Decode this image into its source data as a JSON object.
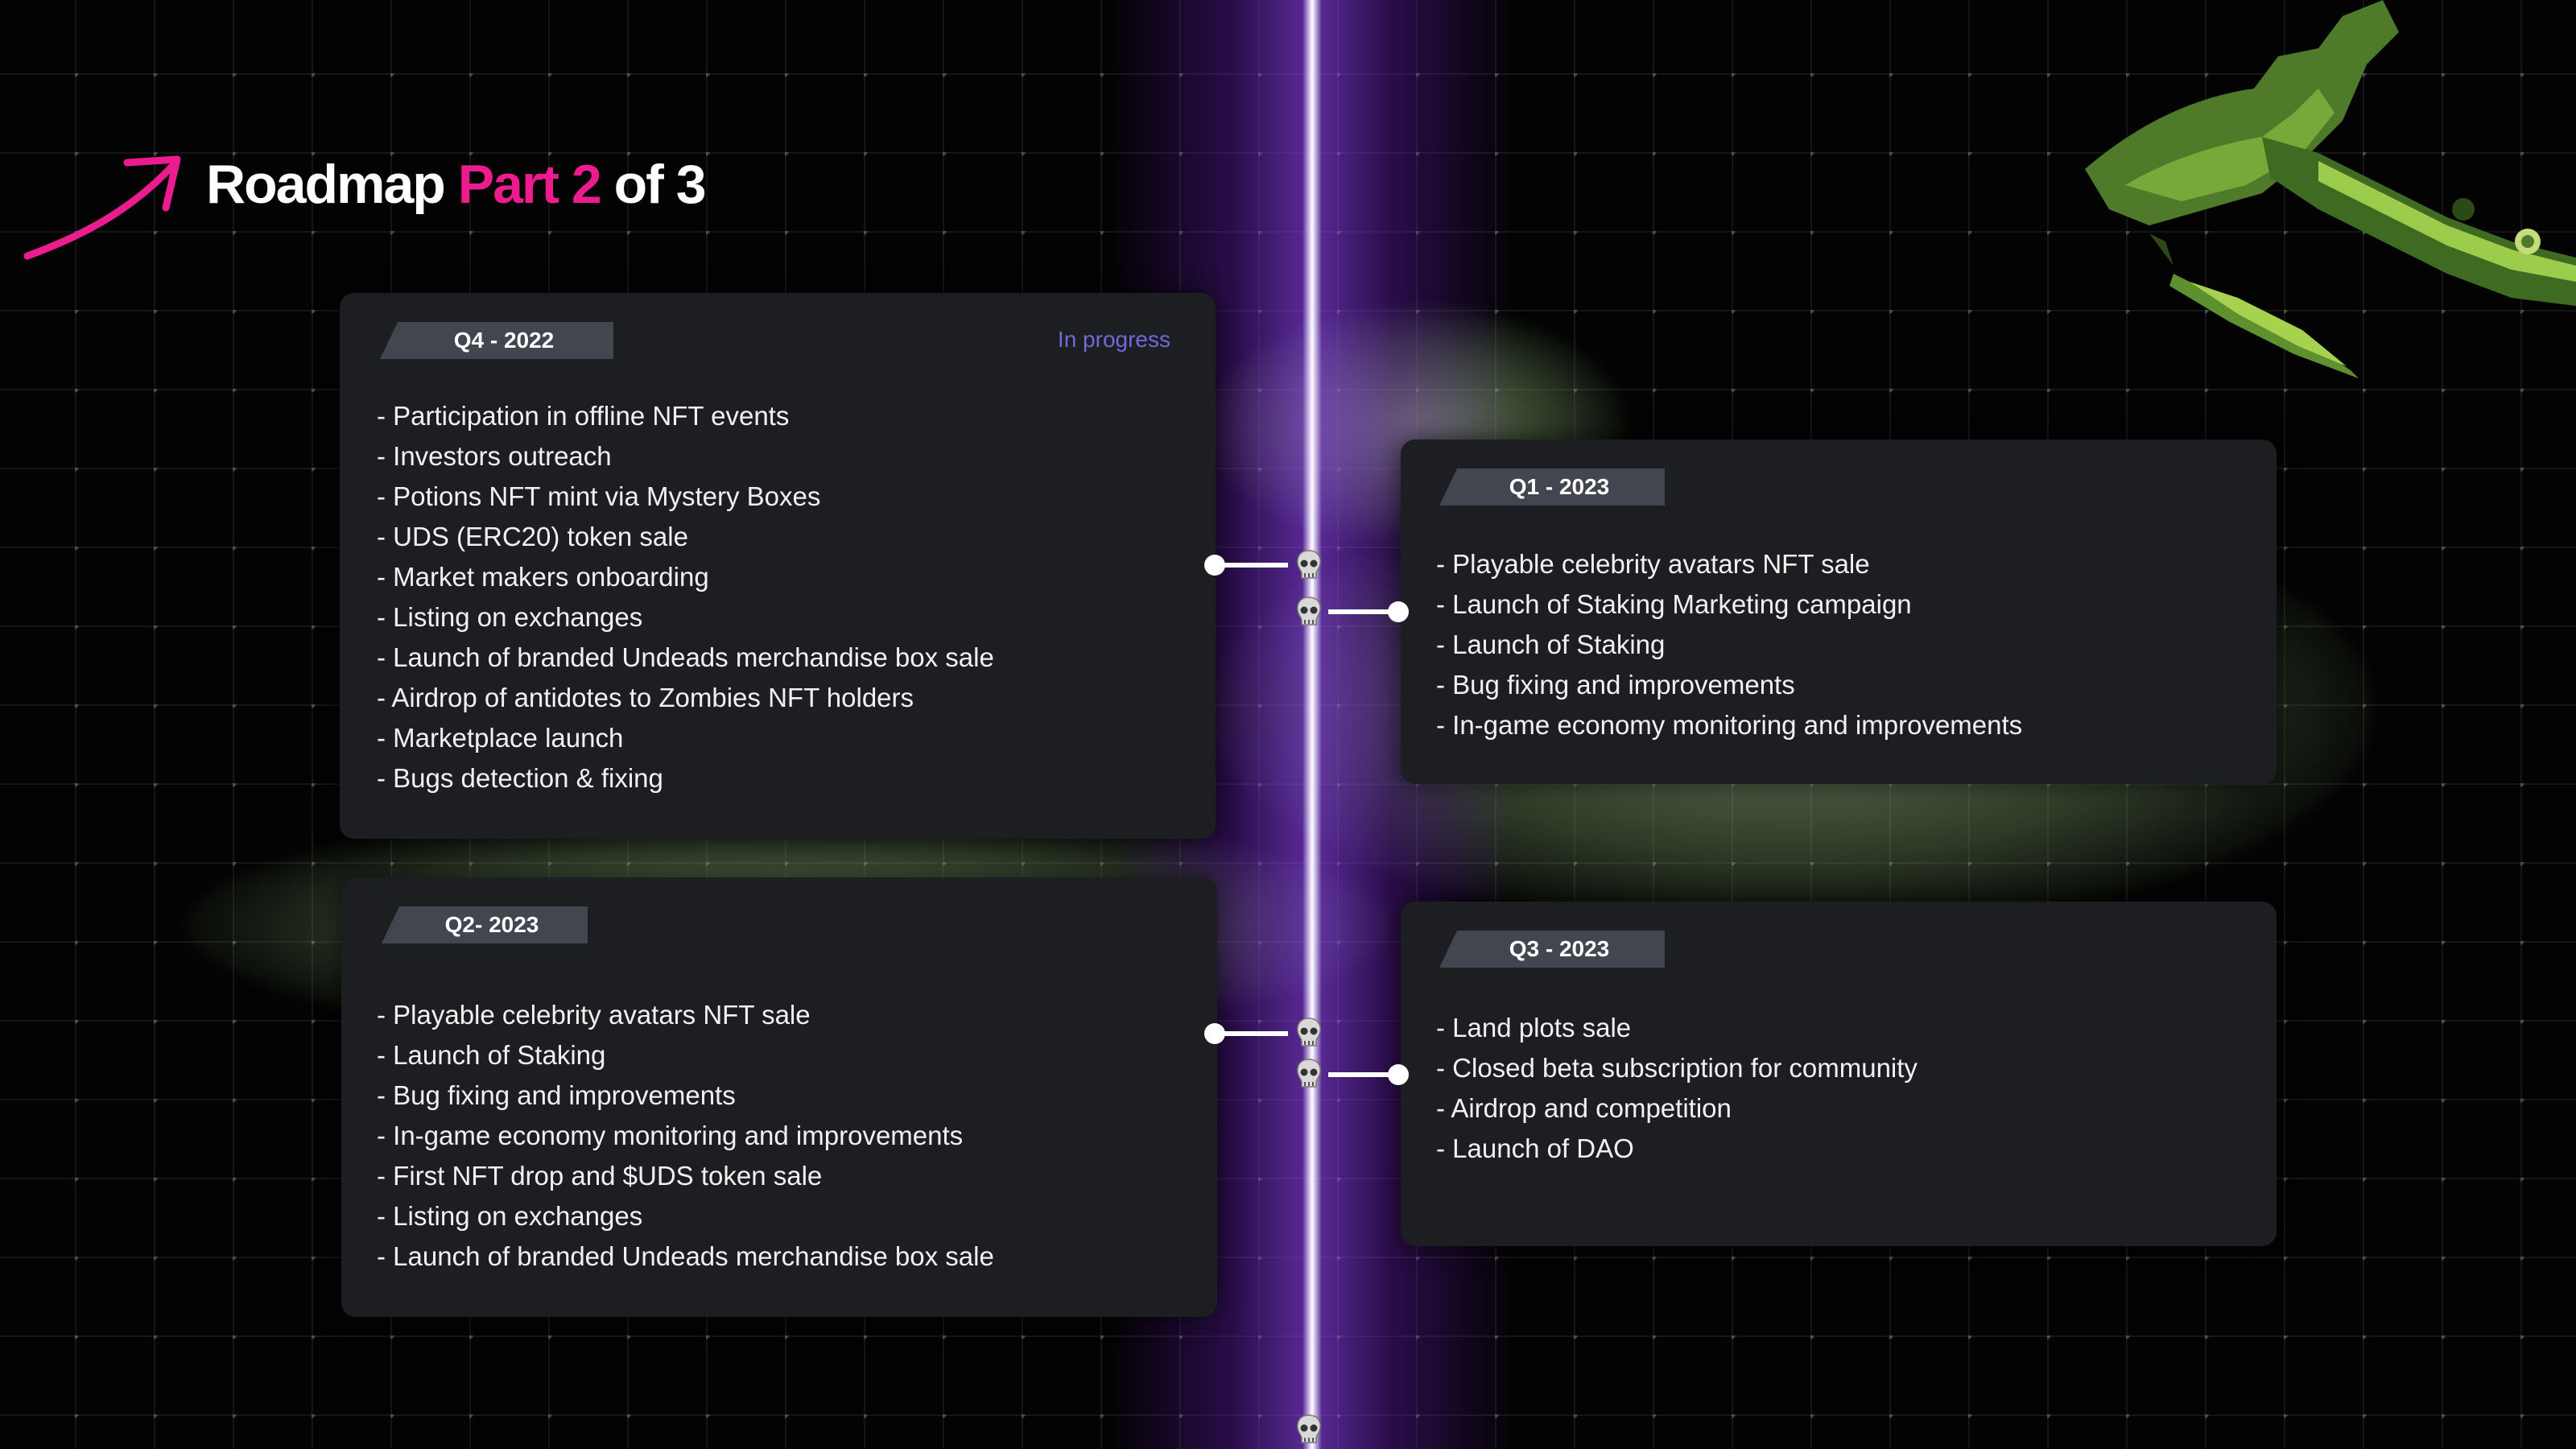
{
  "header": {
    "title_prefix": "Roadmap",
    "title_accent": "Part 2",
    "title_suffix": "of 3"
  },
  "colors": {
    "accent": "#ec1c8e",
    "card_bg": "#1d1e22",
    "tag_bg": "#43464e",
    "status": "#6d6ad9",
    "beam": "#9c4dff"
  },
  "cards": [
    {
      "period": "Q4 - 2022",
      "status": "In progress",
      "items": [
        "- Participation in offline NFT events",
        "- Investors outreach",
        "- Potions NFT mint via Mystery Boxes",
        "- UDS (ERC20) token sale",
        "- Market makers onboarding",
        "- Listing on exchanges",
        "- Launch of branded Undeads merchandise box sale",
        "- Airdrop of antidotes to Zombies NFT holders",
        "- Marketplace launch",
        "- Bugs detection & fixing"
      ]
    },
    {
      "period": "Q1 - 2023",
      "items": [
        "- Playable celebrity avatars NFT sale",
        "- Launch of  Staking Marketing campaign",
        "- Launch of Staking",
        "- Bug fixing and improvements",
        "- In-game economy monitoring and improvements"
      ]
    },
    {
      "period": "Q2- 2023",
      "items": [
        " - Playable celebrity avatars NFT sale",
        "- Launch of Staking",
        "- Bug fixing and improvements",
        "- In-game economy monitoring and improvements",
        "- First NFT drop and $UDS token sale",
        "- Listing on exchanges",
        "- Launch of branded Undeads merchandise box sale"
      ]
    },
    {
      "period": "Q3 - 2023",
      "items": [
        "- Land plots sale",
        "- Closed beta subscription for community",
        "- Airdrop and competition",
        "- Launch of DAO"
      ]
    }
  ]
}
